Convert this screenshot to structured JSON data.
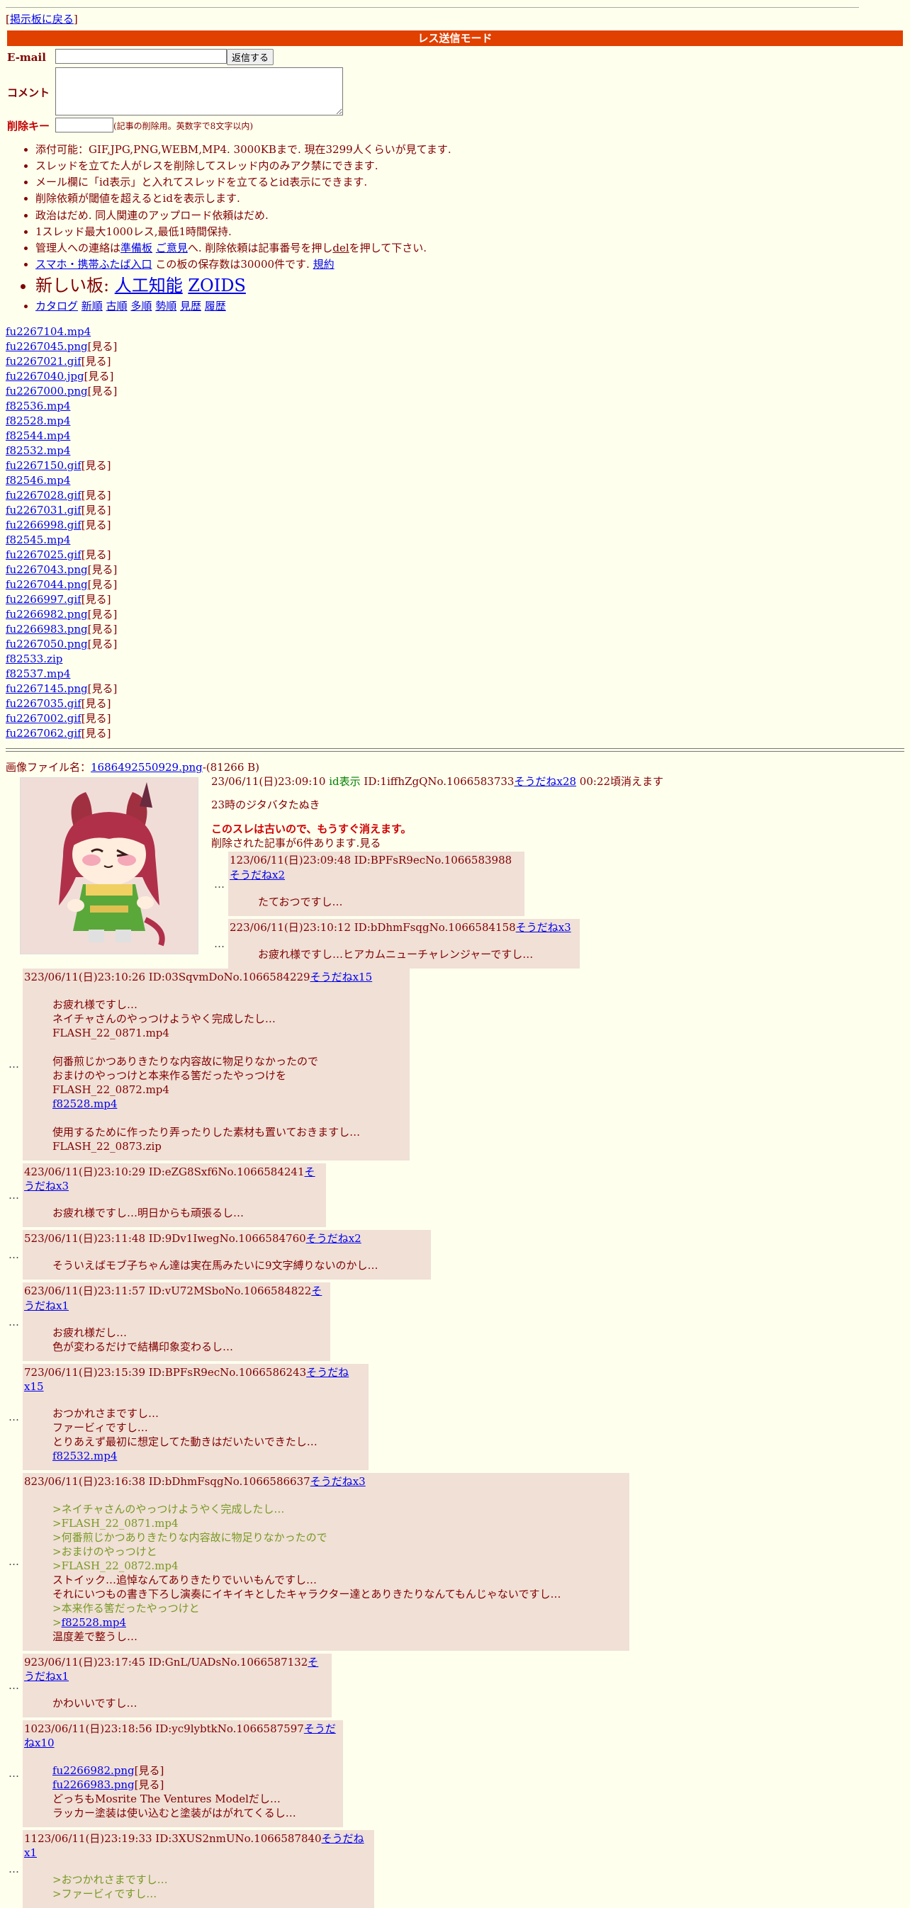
{
  "nav": {
    "back_open": "[",
    "back_link": "掲示板に戻る",
    "back_close": "]"
  },
  "mode_bar": "レス送信モード",
  "form": {
    "email_label": "E-mail",
    "submit_label": "返信する",
    "comment_label": "コメント",
    "delkey_label": "削除キー",
    "delkey_note": "(記事の削除用。英数字で8文字以内)"
  },
  "rules": [
    "添付可能：GIF,JPG,PNG,WEBM,MP4. 3000KBまで. 現在3299人くらいが見てます.",
    "スレッドを立てた人がレスを削除してスレッド内のみアク禁にできます.",
    "メール欄に「id表示」と入れてスレッドを立てるとid表示にできます.",
    "削除依頼が閾値を超えるとidを表示します.",
    "政治はだめ. 同人関連のアップロード依頼はだめ.",
    "1スレッド最大1000レス,最低1時間保持."
  ],
  "contact": {
    "pre": "管理人への連絡は",
    "link1": "準備板",
    "mid": " ",
    "link2": "ご意見",
    "post": "へ. 削除依頼は記事番号を押し",
    "del": "del",
    "post2": "を押して下さい."
  },
  "mobile": {
    "link": "スマホ・携帯ふたば入口",
    "text": " この板の保存数は30000件です. ",
    "rule_link": "規約"
  },
  "newboard": {
    "label": "新しい板: ",
    "link1": "人工知能",
    "link2": "ZOIDS"
  },
  "catalog_links": [
    "カタログ",
    "新順",
    "古順",
    "多順",
    "勢順",
    "見歴",
    "履歴"
  ],
  "files": [
    {
      "name": "fu2267104.mp4",
      "see": ""
    },
    {
      "name": "fu2267045.png",
      "see": "[見る]"
    },
    {
      "name": "fu2267021.gif",
      "see": "[見る]"
    },
    {
      "name": "fu2267040.jpg",
      "see": "[見る]"
    },
    {
      "name": "fu2267000.png",
      "see": "[見る]"
    },
    {
      "name": "f82536.mp4",
      "see": ""
    },
    {
      "name": "f82528.mp4",
      "see": ""
    },
    {
      "name": "f82544.mp4",
      "see": ""
    },
    {
      "name": "f82532.mp4",
      "see": ""
    },
    {
      "name": "fu2267150.gif",
      "see": "[見る]"
    },
    {
      "name": "f82546.mp4",
      "see": ""
    },
    {
      "name": "fu2267028.gif",
      "see": "[見る]"
    },
    {
      "name": "fu2267031.gif",
      "see": "[見る]"
    },
    {
      "name": "fu2266998.gif",
      "see": "[見る]"
    },
    {
      "name": "f82545.mp4",
      "see": ""
    },
    {
      "name": "fu2267025.gif",
      "see": "[見る]"
    },
    {
      "name": "fu2267043.png",
      "see": "[見る]"
    },
    {
      "name": "fu2267044.png",
      "see": "[見る]"
    },
    {
      "name": "fu2266997.gif",
      "see": "[見る]"
    },
    {
      "name": "fu2266982.png",
      "see": "[見る]"
    },
    {
      "name": "fu2266983.png",
      "see": "[見る]"
    },
    {
      "name": "fu2267050.png",
      "see": "[見る]"
    },
    {
      "name": "f82533.zip",
      "see": ""
    },
    {
      "name": "f82537.mp4",
      "see": ""
    },
    {
      "name": "fu2267145.png",
      "see": "[見る]"
    },
    {
      "name": "fu2267035.gif",
      "see": "[見る]"
    },
    {
      "name": "fu2267002.gif",
      "see": "[見る]"
    },
    {
      "name": "fu2267062.gif",
      "see": "[見る]"
    }
  ],
  "op": {
    "file_label": "画像ファイル名：",
    "file_link": "1686492550929.png",
    "file_size": "-(81266 B)",
    "date": "23/06/11(日)23:09:10 ",
    "id_mode": "id表示",
    "id_no": " ID:1iffhZgQNo.1066583733",
    "soudane": "そうだねx28",
    "expire": " 00:22頃消えます",
    "body": "23時のジタバタたぬき",
    "warning": "このスレは古いので、もうすぐ消えます。",
    "deleted": "削除された記事が6件あります.見る"
  },
  "small_replies": [
    {
      "head": "123/06/11(日)23:09:48 ID:BPFsR9ecNo.1066583988",
      "sd": "そうだねx2",
      "lines": [
        "たておつですし…"
      ]
    },
    {
      "head": "223/06/11(日)23:10:12 ID:bDhmFsqgNo.1066584158",
      "sd": "そうだねx3",
      "lines": [
        "お疲れ様ですし…ヒアカムニューチャレンジャーですし…"
      ]
    }
  ],
  "ellipsis": "…",
  "replies": [
    {
      "head": "323/06/11(日)23:10:26 ID:03SqvmDoNo.1066584229",
      "sd": "そうだねx15",
      "lines": [
        {
          "t": "お疲れ様ですし…"
        },
        {
          "t": "ネイチャさんのやっつけようやく完成したし…"
        },
        {
          "t": "FLASH_22_0871.mp4"
        },
        {
          "t": ""
        },
        {
          "t": "何番煎じかつありきたりな内容故に物足りなかったので"
        },
        {
          "t": "おまけのやっつけと本来作る筈だったやっつけを"
        },
        {
          "t": "FLASH_22_0872.mp4"
        },
        {
          "t": "f82528.mp4",
          "link": true
        },
        {
          "t": ""
        },
        {
          "t": "使用するために作ったり弄ったりした素材も置いておきますし…"
        },
        {
          "t": "FLASH_22_0873.zip"
        }
      ]
    },
    {
      "head": "423/06/11(日)23:10:29 ID:eZG8Sxf6No.1066584241",
      "sd": "そうだねx3",
      "lines": [
        {
          "t": "お疲れ様ですし…明日からも頑張るし…"
        }
      ]
    },
    {
      "head": "523/06/11(日)23:11:48 ID:9Dv1IwegNo.1066584760",
      "sd": "そうだねx2",
      "lines": [
        {
          "t": "そういえばモブ子ちゃん達は実在馬みたいに9文字縛りないのかし…"
        }
      ]
    },
    {
      "head": "623/06/11(日)23:11:57 ID:vU72MSboNo.1066584822",
      "sd": "そうだねx1",
      "lines": [
        {
          "t": "お疲れ様だし…"
        },
        {
          "t": "色が変わるだけで結構印象変わるし…"
        }
      ]
    },
    {
      "head": "723/06/11(日)23:15:39 ID:BPFsR9ecNo.1066586243",
      "sd": "そうだねx15",
      "lines": [
        {
          "t": "おつかれさまですし…"
        },
        {
          "t": "ファービィですし…"
        },
        {
          "t": "とりあえず最初に想定してた動きはだいたいできたし…"
        },
        {
          "t": "f82532.mp4",
          "link": true
        }
      ]
    },
    {
      "head": "823/06/11(日)23:16:38 ID:bDhmFsqgNo.1066586637",
      "sd": "そうだねx3",
      "lines": [
        {
          "t": ">ネイチャさんのやっつけようやく完成したし…",
          "q": true
        },
        {
          "t": ">FLASH_22_0871.mp4",
          "q": true
        },
        {
          "t": ">何番煎じかつありきたりな内容故に物足りなかったので",
          "q": true
        },
        {
          "t": ">おまけのやっつけと",
          "q": true
        },
        {
          "t": ">FLASH_22_0872.mp4",
          "q": true
        },
        {
          "t": "ストイック…追悼なんてありきたりでいいもんですし…"
        },
        {
          "t": "それにいつもの書き下ろし演奏にイキイキとしたキャラクター達とありきたりなんてもんじゃないですし…"
        },
        {
          "t": ">本来作る筈だったやっつけと",
          "q": true
        },
        {
          "t": "f82528.mp4",
          "qlink": true
        },
        {
          "t": "温度差で整うし…"
        }
      ]
    },
    {
      "head": "923/06/11(日)23:17:45 ID:GnL/UADsNo.1066587132",
      "sd": "そうだねx1",
      "lines": [
        {
          "t": "かわいいですし…"
        }
      ]
    },
    {
      "head": "1023/06/11(日)23:18:56 ID:yc9lybtkNo.1066587597",
      "sd": "そうだねx10",
      "lines": [
        {
          "t": "fu2266982.png",
          "link": true,
          "see": "[見る]"
        },
        {
          "t": "fu2266983.png",
          "link": true,
          "see": "[見る]"
        },
        {
          "t": "どっちもMosrite The Ventures Modelだし…"
        },
        {
          "t": "ラッカー塗装は使い込むと塗装がはがれてくるし…"
        }
      ]
    },
    {
      "head": "1123/06/11(日)23:19:33 ID:3XUS2nmUNo.1066587840",
      "sd": "そうだねx1",
      "lines": [
        {
          "t": ">おつかれさまですし…",
          "q": true
        },
        {
          "t": ">ファービィですし…",
          "q": true
        }
      ]
    }
  ],
  "colors": {
    "bg": "#ffffee",
    "text": "#800000",
    "reply_bg": "#f0e0d6",
    "mode_bar": "#e04000",
    "quote": "#789922"
  }
}
